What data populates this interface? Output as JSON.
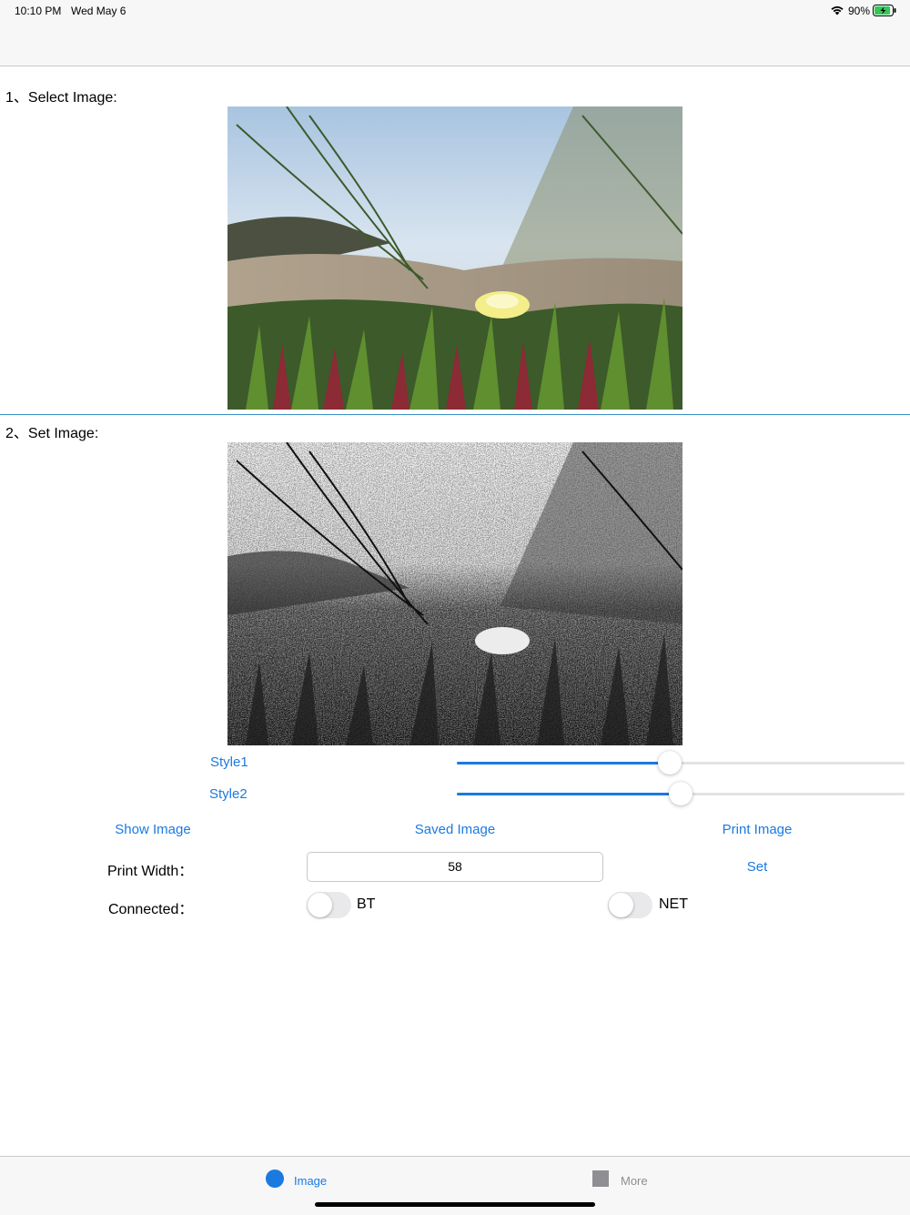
{
  "status_bar": {
    "time": "10:10 PM",
    "date": "Wed May 6",
    "battery_percent": "90%",
    "battery_level": 0.9
  },
  "sections": {
    "select_label": "1、Select Image:",
    "set_label": "2、Set Image:"
  },
  "sliders": [
    {
      "label": "Style1",
      "value": 0.475
    },
    {
      "label": "Style2",
      "value": 0.5
    }
  ],
  "actions": {
    "show_image": "Show Image",
    "saved_image": "Saved Image",
    "print_image": "Print Image"
  },
  "print_width": {
    "label": "Print Width：",
    "value": "58",
    "set_label": "Set"
  },
  "connection": {
    "label": "Connected：",
    "bt_label": "BT",
    "bt_on": false,
    "net_label": "NET",
    "net_on": false
  },
  "tab_bar": {
    "items": [
      {
        "label": "Image",
        "selected": true
      },
      {
        "label": "More",
        "selected": false
      }
    ]
  },
  "colors": {
    "accent": "#1a7ae0",
    "inactive_tab": "#8e8e93",
    "battery_fill": "#34c759"
  }
}
